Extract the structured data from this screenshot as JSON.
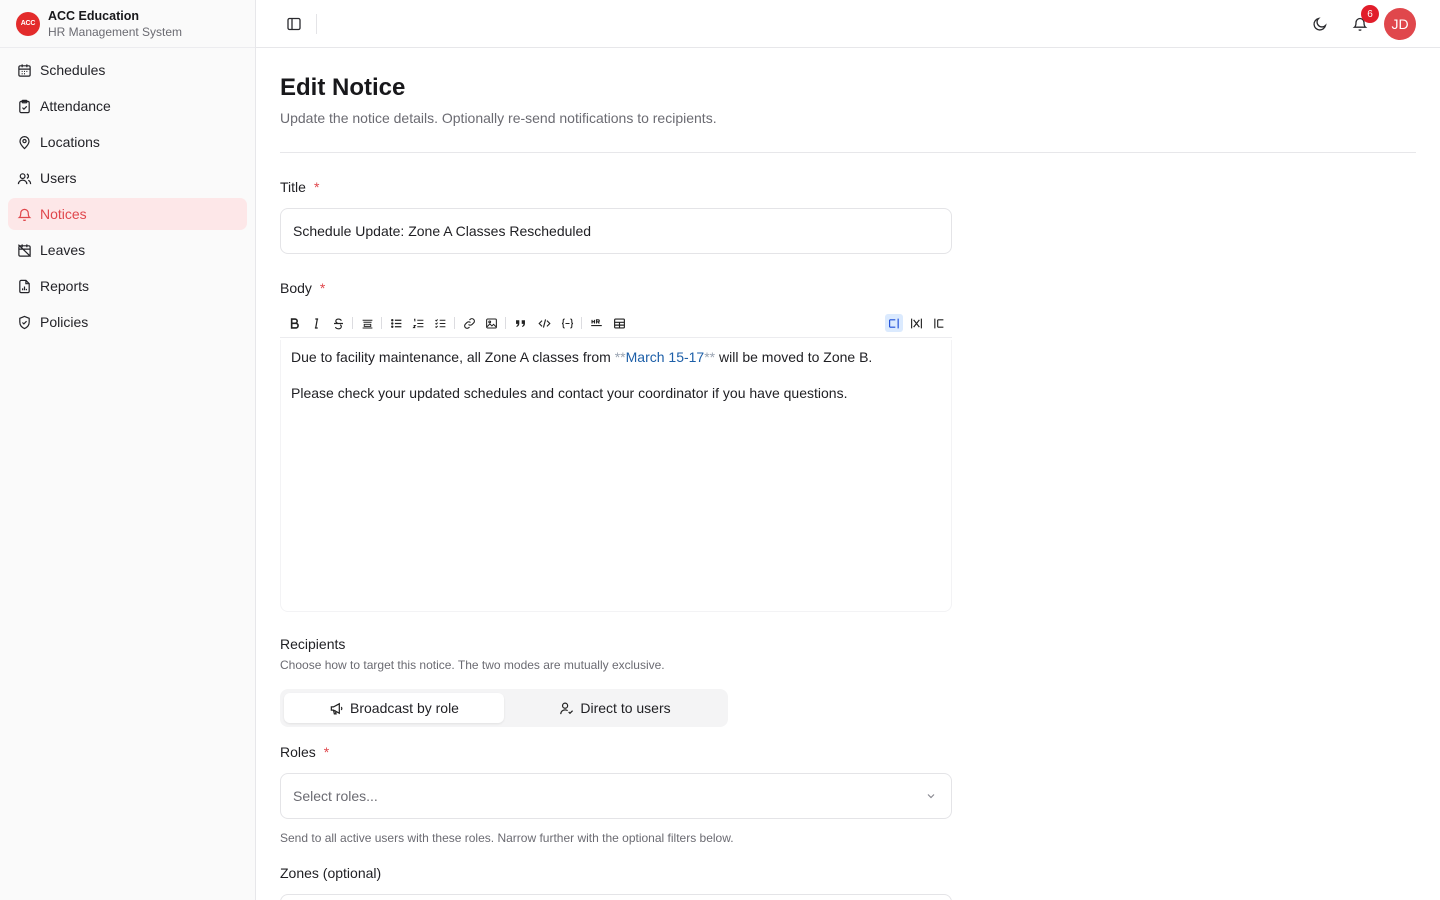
{
  "brand": {
    "logo_text": "ACC",
    "name": "ACC Education",
    "subtitle": "HR Management System"
  },
  "sidebar": {
    "items": [
      {
        "label": "Schedules",
        "icon": "calendar-icon"
      },
      {
        "label": "Attendance",
        "icon": "clipboard-check-icon"
      },
      {
        "label": "Locations",
        "icon": "map-pin-icon"
      },
      {
        "label": "Users",
        "icon": "users-icon"
      },
      {
        "label": "Notices",
        "icon": "bell-icon",
        "active": true
      },
      {
        "label": "Leaves",
        "icon": "calendar-off-icon"
      },
      {
        "label": "Reports",
        "icon": "file-chart-icon"
      },
      {
        "label": "Policies",
        "icon": "shield-check-icon"
      }
    ]
  },
  "topbar": {
    "notification_count": "6",
    "avatar_initials": "JD"
  },
  "page": {
    "title": "Edit Notice",
    "description": "Update the notice details. Optionally re-send notifications to recipients."
  },
  "form": {
    "title_label": "Title",
    "title_value": "Schedule Update: Zone A Classes Rescheduled",
    "body_label": "Body",
    "required_mark": "*",
    "body": {
      "p1_before": "Due to facility maintenance, all Zone A classes from ",
      "p1_marker_open": "**",
      "p1_highlight": "March 15-17",
      "p1_marker_close": "**",
      "p1_after": " will be moved to Zone B.",
      "p2": "Please check your updated schedules and contact your coordinator if you have questions."
    },
    "recipients_title": "Recipients",
    "recipients_desc": "Choose how to target this notice. The two modes are mutually exclusive.",
    "mode_broadcast": "Broadcast by role",
    "mode_direct": "Direct to users",
    "roles_label": "Roles",
    "roles_placeholder": "Select roles...",
    "roles_help": "Send to all active users with these roles. Narrow further with the optional filters below.",
    "zones_label": "Zones (optional)"
  },
  "colors": {
    "accent": "#e0474c",
    "active_bg": "#fde7e8",
    "badge": "#e11d2a"
  }
}
